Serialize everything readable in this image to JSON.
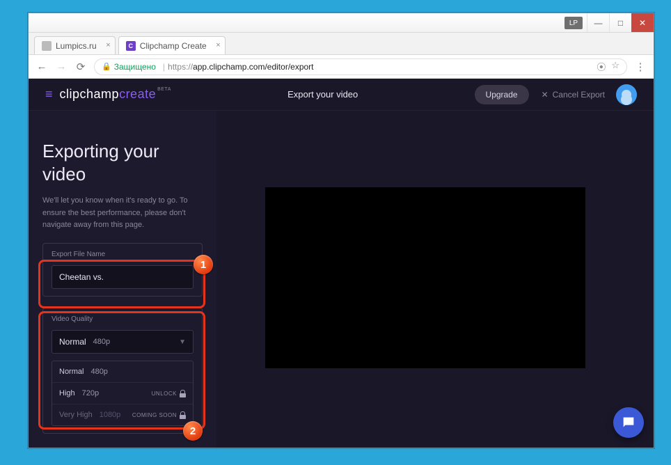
{
  "window": {
    "lp_badge": "LP",
    "minimize": "—",
    "maximize": "□",
    "close": "✕"
  },
  "tabs": [
    {
      "label": "Lumpics.ru",
      "close": "×"
    },
    {
      "label": "Clipchamp Create",
      "favicon": "C",
      "close": "×"
    }
  ],
  "address": {
    "secure_label": "Защищено",
    "url_prefix": "https://",
    "url": "app.clipchamp.com/editor/export"
  },
  "header": {
    "brand1": "clipchamp",
    "brand2": "create",
    "beta": "BETA",
    "center": "Export your video",
    "upgrade": "Upgrade",
    "cancel": "Cancel Export"
  },
  "sidebar": {
    "title": "Exporting your video",
    "subtitle": "We'll let you know when it's ready to go. To ensure the best performance, please don't navigate away from this page.",
    "filename_label": "Export File Name",
    "filename_value": "Cheetan vs.",
    "quality_label": "Video Quality",
    "selected": {
      "name": "Normal",
      "res": "480p"
    },
    "options": [
      {
        "name": "Normal",
        "res": "480p",
        "tag": ""
      },
      {
        "name": "High",
        "res": "720p",
        "tag": "UNLOCK"
      },
      {
        "name": "Very High",
        "res": "1080p",
        "tag": "COMING SOON"
      }
    ]
  },
  "badges": {
    "one": "1",
    "two": "2"
  }
}
